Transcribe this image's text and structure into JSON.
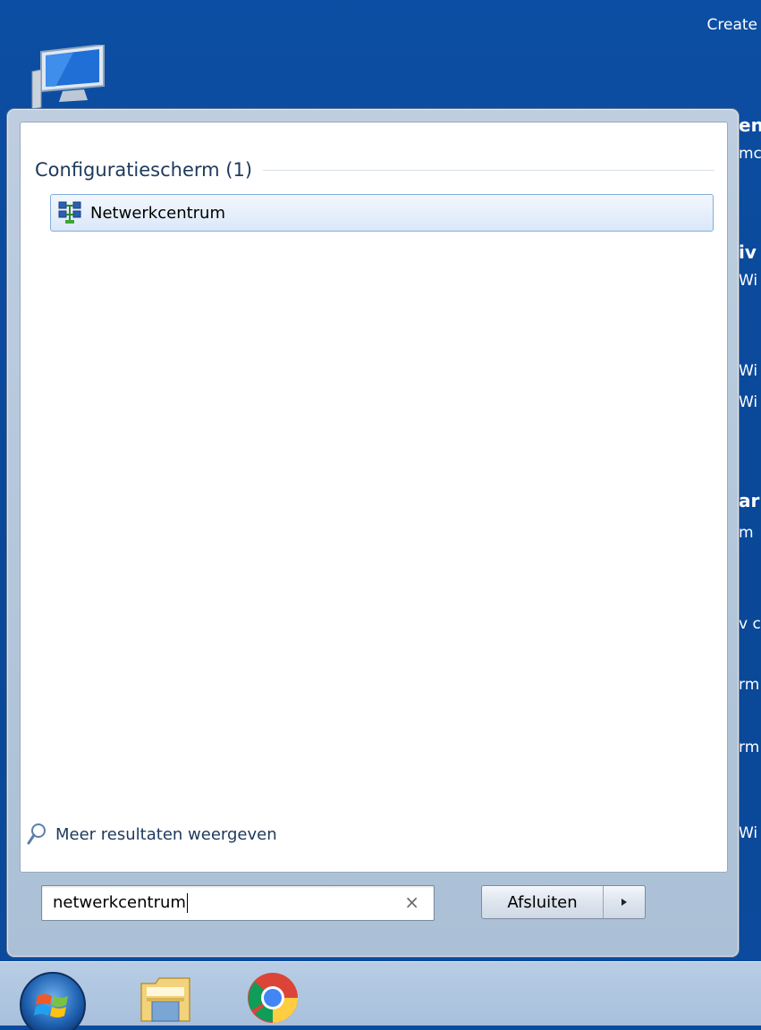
{
  "background_window": {
    "title_fragment": "Create",
    "right_fragments": [
      {
        "text": "en",
        "bold": true
      },
      {
        "text": "mc",
        "bold": false
      },
      {
        "text": "iv",
        "bold": true
      },
      {
        "text": "Wi",
        "bold": false
      },
      {
        "text": "Wi",
        "bold": false
      },
      {
        "text": "Wi",
        "bold": false
      },
      {
        "text": "ar",
        "bold": true
      },
      {
        "text": "m",
        "bold": false
      },
      {
        "text": "v c",
        "bold": false
      },
      {
        "text": "rm",
        "bold": false
      },
      {
        "text": "rm",
        "bold": false
      },
      {
        "text": "Wi",
        "bold": false
      }
    ]
  },
  "start_menu": {
    "group_title": "Configuratiescherm (1)",
    "results": [
      {
        "label": "Netwerkcentrum",
        "icon": "network-center-icon",
        "highlighted": true
      }
    ],
    "more_results_label": "Meer resultaten weergeven",
    "search": {
      "value": "netwerkcentrum",
      "clear_icon": "×"
    },
    "shutdown": {
      "label": "Afsluiten",
      "arrow_icon": "chevron-right-icon"
    }
  },
  "taskbar": {
    "items": [
      {
        "name": "start-orb",
        "icon": "windows-logo-icon"
      },
      {
        "name": "explorer",
        "icon": "folder-icon"
      },
      {
        "name": "chrome",
        "icon": "chrome-icon"
      }
    ]
  },
  "colors": {
    "desktop_blue": "#0b4a9c",
    "menu_frame": "#c4d2e2",
    "group_title": "#1e395b",
    "highlight_border": "#84acdd"
  }
}
